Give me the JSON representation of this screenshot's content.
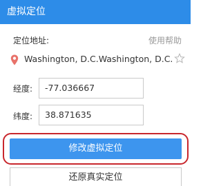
{
  "header": {
    "title": "虚拟定位"
  },
  "location": {
    "label": "定位地址:",
    "help_link": "使用帮助",
    "address": "Washington, D.C.Washington, D.C."
  },
  "longitude": {
    "label": "经度:",
    "value": "-77.036667"
  },
  "latitude": {
    "label": "纬度:",
    "value": "38.871635"
  },
  "buttons": {
    "modify": "修改虚拟定位",
    "restore": "还原真实定位"
  },
  "colors": {
    "header_bg": "#2d8ce8",
    "primary_button": "#3d95ee",
    "pin": "#e8726a",
    "highlight_ring": "#c8262c"
  }
}
